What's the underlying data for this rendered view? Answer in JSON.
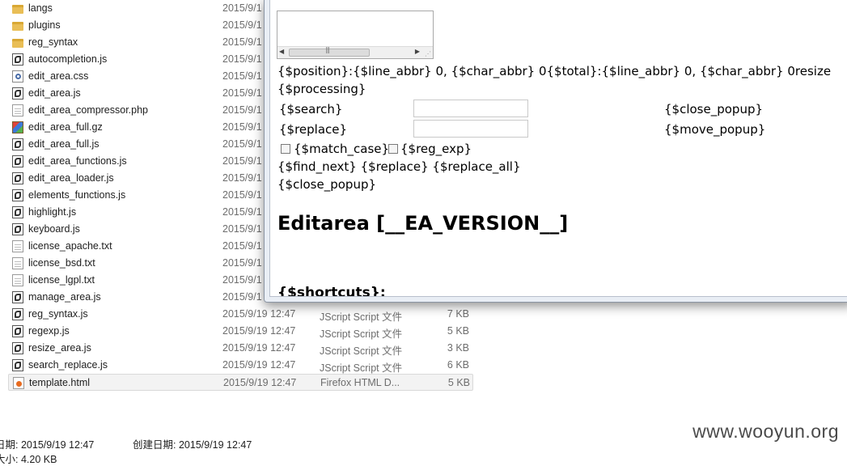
{
  "files": [
    {
      "icon": "folder-icon",
      "name": "langs",
      "date": "2015/9/1",
      "type": "",
      "size": ""
    },
    {
      "icon": "folder-icon",
      "name": "plugins",
      "date": "2015/9/1",
      "type": "",
      "size": ""
    },
    {
      "icon": "folder-icon",
      "name": "reg_syntax",
      "date": "2015/9/1",
      "type": "",
      "size": ""
    },
    {
      "icon": "jscript-file-icon",
      "name": "autocompletion.js",
      "date": "2015/9/1",
      "type": "",
      "size": ""
    },
    {
      "icon": "css-file-icon",
      "name": "edit_area.css",
      "date": "2015/9/1",
      "type": "",
      "size": ""
    },
    {
      "icon": "jscript-file-icon",
      "name": "edit_area.js",
      "date": "2015/9/1",
      "type": "",
      "size": ""
    },
    {
      "icon": "blank-file-icon",
      "name": "edit_area_compressor.php",
      "date": "2015/9/1",
      "type": "",
      "size": ""
    },
    {
      "icon": "archive-file-icon",
      "name": "edit_area_full.gz",
      "date": "2015/9/1",
      "type": "",
      "size": ""
    },
    {
      "icon": "jscript-file-icon",
      "name": "edit_area_full.js",
      "date": "2015/9/1",
      "type": "",
      "size": ""
    },
    {
      "icon": "jscript-file-icon",
      "name": "edit_area_functions.js",
      "date": "2015/9/1",
      "type": "",
      "size": ""
    },
    {
      "icon": "jscript-file-icon",
      "name": "edit_area_loader.js",
      "date": "2015/9/1",
      "type": "",
      "size": ""
    },
    {
      "icon": "jscript-file-icon",
      "name": "elements_functions.js",
      "date": "2015/9/1",
      "type": "",
      "size": ""
    },
    {
      "icon": "jscript-file-icon",
      "name": "highlight.js",
      "date": "2015/9/1",
      "type": "",
      "size": ""
    },
    {
      "icon": "jscript-file-icon",
      "name": "keyboard.js",
      "date": "2015/9/1",
      "type": "",
      "size": ""
    },
    {
      "icon": "text-file-icon",
      "name": "license_apache.txt",
      "date": "2015/9/1",
      "type": "",
      "size": ""
    },
    {
      "icon": "text-file-icon",
      "name": "license_bsd.txt",
      "date": "2015/9/1",
      "type": "",
      "size": ""
    },
    {
      "icon": "text-file-icon",
      "name": "license_lgpl.txt",
      "date": "2015/9/1",
      "type": "",
      "size": ""
    },
    {
      "icon": "jscript-file-icon",
      "name": "manage_area.js",
      "date": "2015/9/1",
      "type": "",
      "size": ""
    },
    {
      "icon": "jscript-file-icon",
      "name": "reg_syntax.js",
      "date": "2015/9/19 12:47",
      "type": "JScript Script 文件",
      "size": "7 KB"
    },
    {
      "icon": "jscript-file-icon",
      "name": "regexp.js",
      "date": "2015/9/19 12:47",
      "type": "JScript Script 文件",
      "size": "5 KB"
    },
    {
      "icon": "jscript-file-icon",
      "name": "resize_area.js",
      "date": "2015/9/19 12:47",
      "type": "JScript Script 文件",
      "size": "3 KB"
    },
    {
      "icon": "jscript-file-icon",
      "name": "search_replace.js",
      "date": "2015/9/19 12:47",
      "type": "JScript Script 文件",
      "size": "6 KB"
    },
    {
      "icon": "firefox-html-file-icon",
      "name": "template.html",
      "date": "2015/9/19 12:47",
      "type": "Firefox HTML D...",
      "size": "5 KB",
      "selected": true
    }
  ],
  "status": {
    "modified_label": "日期:",
    "modified_value": "2015/9/19 12:47",
    "created_label": "创建日期:",
    "created_value": "2015/9/19 12:47",
    "size_line": "大小: 4.20 KB"
  },
  "watermark": "www.wooyun.org",
  "popup": {
    "position_line": "{$position}:{$line_abbr} 0, {$char_abbr} 0{$total}:{$line_abbr} 0, {$char_abbr} 0resize",
    "processing": "{$processing}",
    "search_label": "{$search}",
    "replace_label": "{$replace}",
    "close_popup_1": "{$close_popup}",
    "move_popup": "{$move_popup}",
    "match_case": "{$match_case}",
    "reg_exp": "{$reg_exp}",
    "action_line": "{$find_next} {$replace} {$replace_all}",
    "close_popup_2": "{$close_popup}",
    "heading": "Editarea [__EA_VERSION__]",
    "shortcuts": "{$shortcuts}:"
  }
}
